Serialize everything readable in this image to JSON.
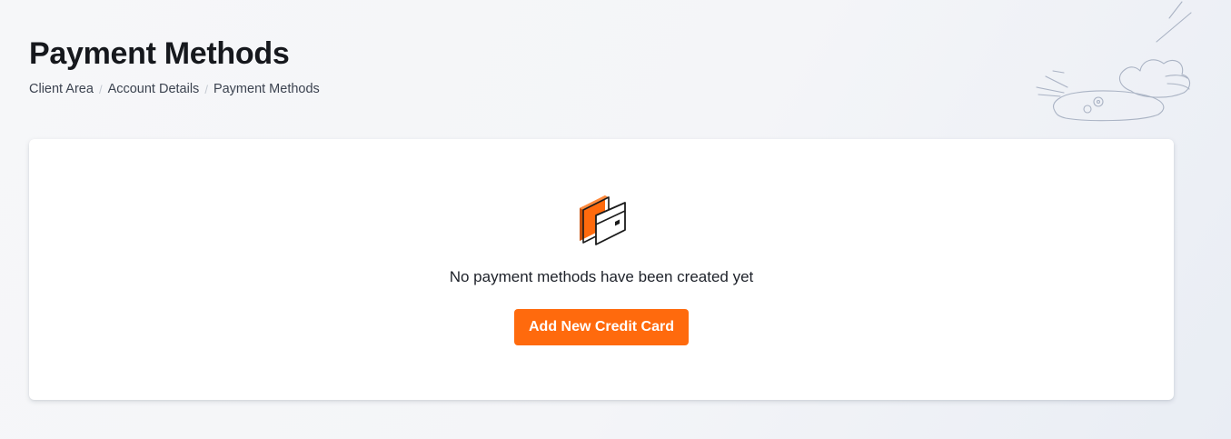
{
  "page": {
    "title": "Payment Methods"
  },
  "breadcrumb": {
    "items": [
      {
        "label": "Client Area"
      },
      {
        "label": "Account Details"
      },
      {
        "label": "Payment Methods"
      }
    ],
    "separator": "/"
  },
  "empty_state": {
    "icon": "credit-card-icon",
    "message": "No payment methods have been created yet",
    "button_label": "Add New Credit Card"
  },
  "colors": {
    "accent": "#ff6a0d",
    "text": "#1d2129",
    "card_background": "#ffffff"
  }
}
